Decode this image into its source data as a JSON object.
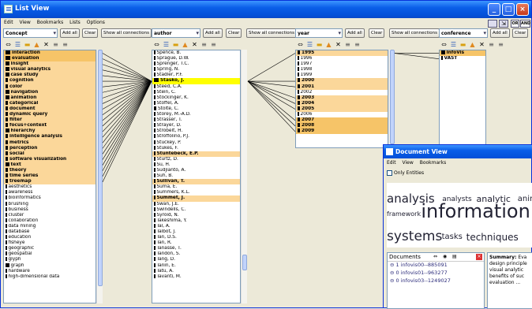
{
  "window": {
    "title": "List View",
    "min": "_",
    "max": "□",
    "close": "×"
  },
  "menu": [
    "Edit",
    "View",
    "Bookmarks",
    "Lists",
    "Options"
  ],
  "top_right": {
    "or_label": "OR",
    "and_label": "AND"
  },
  "buttons": {
    "add_all": "Add all",
    "clear": "Clear",
    "show_all": "Show all connections"
  },
  "columns": {
    "concept": {
      "name": "Concept",
      "rows": [
        {
          "t": "interaction",
          "w": 4,
          "b": 1,
          "h": 2
        },
        {
          "t": "evaluation",
          "w": 4,
          "b": 1,
          "h": 2
        },
        {
          "t": "insight",
          "w": 3,
          "b": 1,
          "h": 1
        },
        {
          "t": "visual analytics",
          "w": 3,
          "b": 1,
          "h": 1
        },
        {
          "t": "case study",
          "w": 3,
          "b": 1,
          "h": 1
        },
        {
          "t": "cognition",
          "w": 2,
          "b": 1,
          "h": 1
        },
        {
          "t": "color",
          "w": 2,
          "b": 1,
          "h": 1
        },
        {
          "t": "navigation",
          "w": 3,
          "b": 1,
          "h": 1
        },
        {
          "t": "animation",
          "w": 3,
          "b": 1,
          "h": 1
        },
        {
          "t": "categorical",
          "w": 2,
          "b": 1,
          "h": 1
        },
        {
          "t": "document",
          "w": 2,
          "b": 1,
          "h": 1
        },
        {
          "t": "dynamic query",
          "w": 2,
          "b": 1,
          "h": 1
        },
        {
          "t": "filter",
          "w": 2,
          "b": 1,
          "h": 1
        },
        {
          "t": "focus+context",
          "w": 2,
          "b": 1,
          "h": 1
        },
        {
          "t": "hierarchy",
          "w": 3,
          "b": 1,
          "h": 1
        },
        {
          "t": "intelligence analysis",
          "w": 2,
          "b": 1,
          "h": 1
        },
        {
          "t": "metrics",
          "w": 2,
          "b": 1,
          "h": 1
        },
        {
          "t": "perception",
          "w": 2,
          "b": 1,
          "h": 1
        },
        {
          "t": "social",
          "w": 2,
          "b": 1,
          "h": 1
        },
        {
          "t": "software visualization",
          "w": 2,
          "b": 1,
          "h": 1
        },
        {
          "t": "text",
          "w": 3,
          "b": 1,
          "h": 1
        },
        {
          "t": "theory",
          "w": 2,
          "b": 1,
          "h": 1
        },
        {
          "t": "time series",
          "w": 2,
          "b": 1,
          "h": 1
        },
        {
          "t": "treemap",
          "w": 2,
          "b": 1,
          "h": 1
        },
        {
          "t": "aesthetics",
          "w": 1,
          "b": 0,
          "h": 0
        },
        {
          "t": "awareness",
          "w": 1,
          "b": 0,
          "h": 0
        },
        {
          "t": "bioinformatics",
          "w": 1,
          "b": 0,
          "h": 0
        },
        {
          "t": "brushing",
          "w": 1,
          "b": 0,
          "h": 0
        },
        {
          "t": "business",
          "w": 1,
          "b": 0,
          "h": 0
        },
        {
          "t": "cluster",
          "w": 1,
          "b": 0,
          "h": 0
        },
        {
          "t": "collaboration",
          "w": 1,
          "b": 0,
          "h": 0
        },
        {
          "t": "data mining",
          "w": 1,
          "b": 0,
          "h": 0
        },
        {
          "t": "database",
          "w": 1,
          "b": 0,
          "h": 0
        },
        {
          "t": "education",
          "w": 1,
          "b": 0,
          "h": 0
        },
        {
          "t": "fisheye",
          "w": 1,
          "b": 0,
          "h": 0
        },
        {
          "t": "geographic",
          "w": 1,
          "b": 0,
          "h": 0
        },
        {
          "t": "geospatial",
          "w": 1,
          "b": 0,
          "h": 0
        },
        {
          "t": "glyph",
          "w": 1,
          "b": 0,
          "h": 0
        },
        {
          "t": "graph",
          "w": 3,
          "b": 0,
          "h": 0
        },
        {
          "t": "hardware",
          "w": 1,
          "b": 0,
          "h": 0
        },
        {
          "t": "high-dimensional data",
          "w": 1,
          "b": 0,
          "h": 0
        }
      ]
    },
    "author": {
      "name": "author",
      "rows": [
        {
          "t": "Spence, B.",
          "w": 1,
          "b": 0,
          "h": 0
        },
        {
          "t": "Sprague, D.W.",
          "w": 1,
          "b": 0,
          "h": 0
        },
        {
          "t": "Sprenger, T.C.",
          "w": 1,
          "b": 0,
          "h": 0
        },
        {
          "t": "Spring, N.",
          "w": 1,
          "b": 0,
          "h": 0
        },
        {
          "t": "Stadler, P.F.",
          "w": 1,
          "b": 0,
          "h": 0
        },
        {
          "t": "Stasko, J.",
          "w": 4,
          "b": 1,
          "h": 3
        },
        {
          "t": "Steed, C.A.",
          "w": 1,
          "b": 0,
          "h": 0
        },
        {
          "t": "Stein, C.",
          "w": 1,
          "b": 0,
          "h": 0
        },
        {
          "t": "Stockinger, K.",
          "w": 1,
          "b": 0,
          "h": 0
        },
        {
          "t": "Stoffel, A.",
          "w": 1,
          "b": 0,
          "h": 0
        },
        {
          "t": "Stolte, C.",
          "w": 2,
          "b": 0,
          "h": 0
        },
        {
          "t": "Storey, M.-A.D.",
          "w": 1,
          "b": 0,
          "h": 0
        },
        {
          "t": "Strasser, T.",
          "w": 1,
          "b": 0,
          "h": 0
        },
        {
          "t": "Strayer, D.",
          "w": 1,
          "b": 0,
          "h": 0
        },
        {
          "t": "Strobelt, H.",
          "w": 1,
          "b": 0,
          "h": 0
        },
        {
          "t": "Stroffolino, P.J.",
          "w": 1,
          "b": 0,
          "h": 0
        },
        {
          "t": "Stuckey, P.",
          "w": 1,
          "b": 0,
          "h": 0
        },
        {
          "t": "Stukes, F.",
          "w": 1,
          "b": 0,
          "h": 0
        },
        {
          "t": "Stuntebeck, E.P.",
          "w": 1,
          "b": 1,
          "h": 1
        },
        {
          "t": "Sturtz, D.",
          "w": 1,
          "b": 0,
          "h": 0
        },
        {
          "t": "Su, H.",
          "w": 1,
          "b": 0,
          "h": 0
        },
        {
          "t": "Sudjianto, A.",
          "w": 1,
          "b": 0,
          "h": 0
        },
        {
          "t": "Suh, B.",
          "w": 1,
          "b": 0,
          "h": 0
        },
        {
          "t": "Sullivan, T.",
          "w": 1,
          "b": 1,
          "h": 1
        },
        {
          "t": "Suma, E.",
          "w": 1,
          "b": 0,
          "h": 0
        },
        {
          "t": "Summers, K.L.",
          "w": 1,
          "b": 0,
          "h": 0
        },
        {
          "t": "Summet, J.",
          "w": 1,
          "b": 1,
          "h": 1
        },
        {
          "t": "Swan, J.E.",
          "w": 1,
          "b": 0,
          "h": 0
        },
        {
          "t": "Swindells, C.",
          "w": 1,
          "b": 0,
          "h": 0
        },
        {
          "t": "Syroid, N.",
          "w": 1,
          "b": 0,
          "h": 0
        },
        {
          "t": "Takeshima, Y.",
          "w": 1,
          "b": 0,
          "h": 0
        },
        {
          "t": "Tal, A.",
          "w": 1,
          "b": 0,
          "h": 0
        },
        {
          "t": "Talbot, J.",
          "w": 1,
          "b": 0,
          "h": 0
        },
        {
          "t": "Tan, D.S.",
          "w": 1,
          "b": 0,
          "h": 0
        },
        {
          "t": "Tan, R.",
          "w": 1,
          "b": 0,
          "h": 0
        },
        {
          "t": "Tanasse, T.",
          "w": 1,
          "b": 0,
          "h": 0
        },
        {
          "t": "Tandon, S.",
          "w": 1,
          "b": 0,
          "h": 0
        },
        {
          "t": "Tang, D.",
          "w": 1,
          "b": 0,
          "h": 0
        },
        {
          "t": "Tanin, E.",
          "w": 1,
          "b": 0,
          "h": 0
        },
        {
          "t": "Tatu, A.",
          "w": 1,
          "b": 0,
          "h": 0
        },
        {
          "t": "Tavanti, M.",
          "w": 1,
          "b": 0,
          "h": 0
        }
      ]
    },
    "year": {
      "name": "year",
      "rows": [
        {
          "t": "1995",
          "w": 2,
          "b": 1,
          "h": 1
        },
        {
          "t": "1996",
          "w": 1,
          "b": 0,
          "h": 0
        },
        {
          "t": "1997",
          "w": 1,
          "b": 0,
          "h": 0
        },
        {
          "t": "1998",
          "w": 1,
          "b": 0,
          "h": 0
        },
        {
          "t": "1999",
          "w": 1,
          "b": 0,
          "h": 0
        },
        {
          "t": "2000",
          "w": 2,
          "b": 1,
          "h": 1
        },
        {
          "t": "2001",
          "w": 2,
          "b": 1,
          "h": 1
        },
        {
          "t": "2002",
          "w": 1,
          "b": 0,
          "h": 0
        },
        {
          "t": "2003",
          "w": 2,
          "b": 1,
          "h": 1
        },
        {
          "t": "2004",
          "w": 2,
          "b": 1,
          "h": 1
        },
        {
          "t": "2005",
          "w": 2,
          "b": 1,
          "h": 1
        },
        {
          "t": "2006",
          "w": 1,
          "b": 0,
          "h": 0
        },
        {
          "t": "2007",
          "w": 2,
          "b": 1,
          "h": 2
        },
        {
          "t": "2008",
          "w": 2,
          "b": 1,
          "h": 2
        },
        {
          "t": "2009",
          "w": 2,
          "b": 1,
          "h": 2
        }
      ]
    },
    "conference": {
      "name": "conference",
      "rows": [
        {
          "t": "InfoVis",
          "w": 3,
          "b": 1,
          "h": 2
        },
        {
          "t": "VAST",
          "w": 1,
          "b": 1,
          "h": 0
        }
      ]
    }
  },
  "doc_view": {
    "title": "Document View",
    "menu": [
      "Edit",
      "View",
      "Bookmarks"
    ],
    "only_entities": "Only Entities",
    "cloud": [
      {
        "t": "analysis",
        "s": 15
      },
      {
        "t": "analysts",
        "s": 9
      },
      {
        "t": "analytic",
        "s": 11
      },
      {
        "t": "anima",
        "s": 10
      },
      {
        "t": "framework",
        "s": 8
      },
      {
        "t": "information",
        "s": 24
      },
      {
        "t": "systems",
        "s": 17
      },
      {
        "t": "tasks",
        "s": 10
      },
      {
        "t": "techniques",
        "s": 12
      }
    ],
    "docs_header": "Documents",
    "docs": [
      {
        "n": "1",
        "id": "infovis00--885091"
      },
      {
        "n": "0",
        "id": "infovis01--963277"
      },
      {
        "n": "0",
        "id": "infovis03--1249027"
      }
    ],
    "summary": [
      "Summary: Eva",
      "design principle",
      "visual analytic",
      "benefits of suc",
      "evaluation ..."
    ]
  },
  "colors": {
    "highlight": "#fbd79a",
    "strong": "#f6c468",
    "selected": "#ffff00",
    "title": "#0a5ee8"
  }
}
